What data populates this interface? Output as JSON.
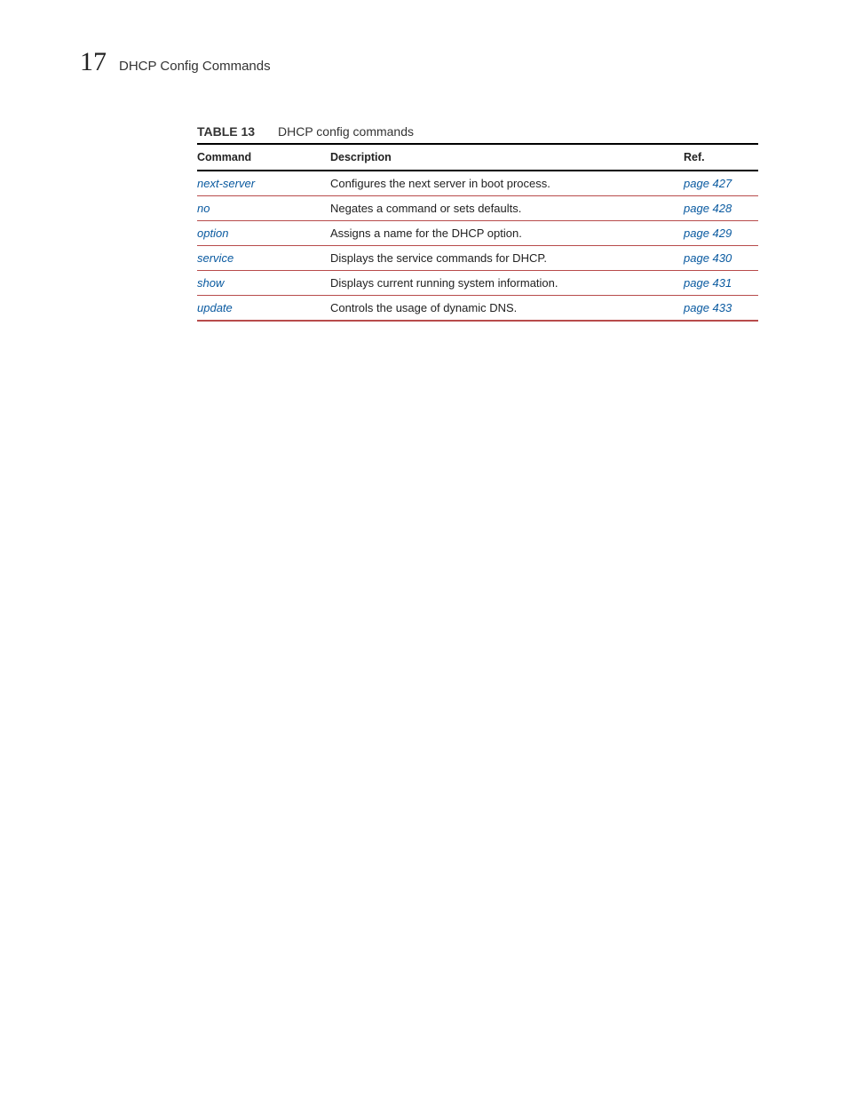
{
  "header": {
    "chapter_number": "17",
    "title": "DHCP Config Commands"
  },
  "table": {
    "label": "TABLE 13",
    "caption": "DHCP config commands",
    "columns": {
      "command": "Command",
      "description": "Description",
      "ref": "Ref."
    },
    "rows": [
      {
        "command": "next-server",
        "description": "Configures the next server in boot process.",
        "ref": "page 427"
      },
      {
        "command": "no",
        "description": "Negates a command or sets defaults.",
        "ref": "page 428"
      },
      {
        "command": "option",
        "description": "Assigns a name for the DHCP option.",
        "ref": "page 429"
      },
      {
        "command": "service",
        "description": "Displays the service commands for DHCP.",
        "ref": "page 430"
      },
      {
        "command": "show",
        "description": "Displays current running system information.",
        "ref": "page 431"
      },
      {
        "command": "update",
        "description": "Controls the usage of dynamic DNS.",
        "ref": "page 433"
      }
    ]
  }
}
